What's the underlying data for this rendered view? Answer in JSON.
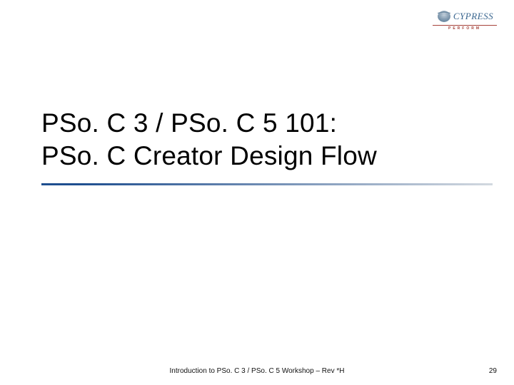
{
  "logo": {
    "brand": "CYPRESS",
    "tagline": "PERFORM"
  },
  "title": {
    "line1": "PSo. C 3 / PSo. C 5 101:",
    "line2": "PSo. C Creator Design Flow"
  },
  "footer": {
    "text": "Introduction to PSo. C 3 / PSo. C 5 Workshop – Rev *H",
    "page": "29"
  }
}
